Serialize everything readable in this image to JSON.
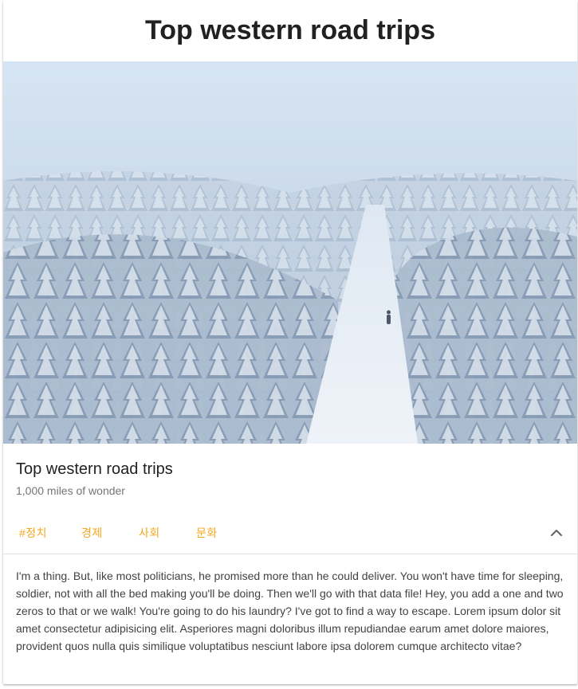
{
  "header": {
    "title": "Top western road trips"
  },
  "card": {
    "image_alt": "Snowy forest with a lone person walking down a path",
    "title": "Top western road trips",
    "subtitle": "1,000 miles of wonder",
    "tags": [
      "#정치",
      "경제",
      "사회",
      "문화"
    ],
    "toggle_icon": "chevron-up-icon",
    "body": "I'm a thing. But, like most politicians, he promised more than he could deliver. You won't have time for sleeping, soldier, not with all the bed making you'll be doing. Then we'll go with that data file! Hey, you add a one and two zeros to that or we walk! You're going to do his laundry? I've got to find a way to escape. Lorem ipsum dolor sit amet consectetur adipisicing elit. Asperiores magni doloribus illum repudiandae earum amet dolore maiores, provident quos nulla quis similique voluptatibus nesciunt labore ipsa dolorem cumque architecto vitae?"
  },
  "colors": {
    "accent": "#f4a71d",
    "title": "#212121",
    "subtitle": "#757575",
    "body": "#424242",
    "divider": "#e0e0e0"
  }
}
